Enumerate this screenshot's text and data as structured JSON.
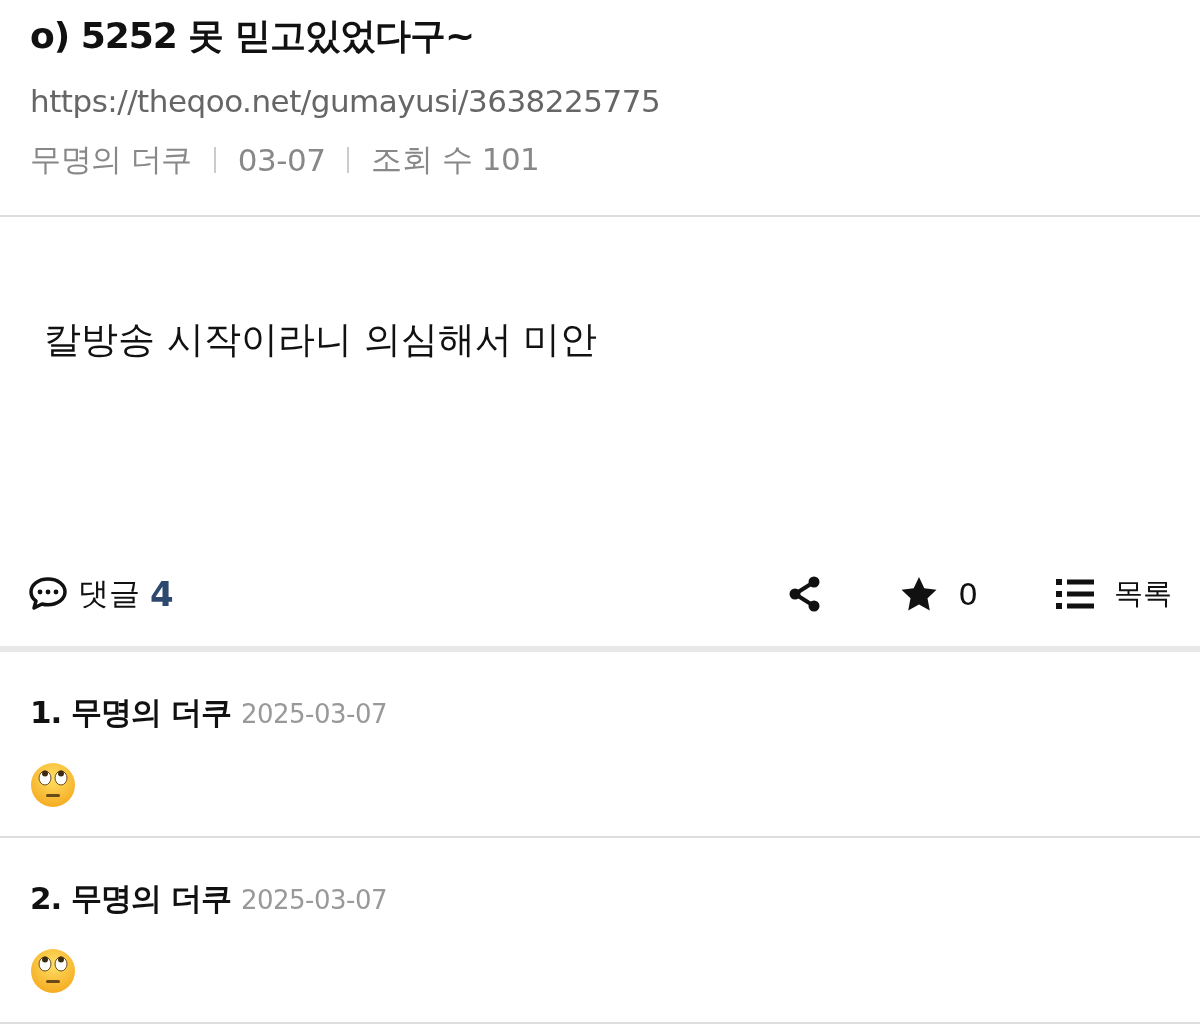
{
  "post": {
    "title": "o) 5252 못 믿고있었다구~",
    "url": "https://theqoo.net/gumayusi/3638225775",
    "meta": [
      "무명의 더쿠",
      "03-07",
      "조회 수 101"
    ],
    "body": "칼방송 시작이라니 의심해서 미안"
  },
  "actions": {
    "comments_label": "댓글",
    "comments_count": "4",
    "star_count": "0",
    "list_label": "목록"
  },
  "comments": [
    {
      "number": "1.",
      "author": "무명의 더쿠",
      "date": "2025-03-07"
    },
    {
      "number": "2.",
      "author": "무명의 더쿠",
      "date": "2025-03-07"
    }
  ]
}
